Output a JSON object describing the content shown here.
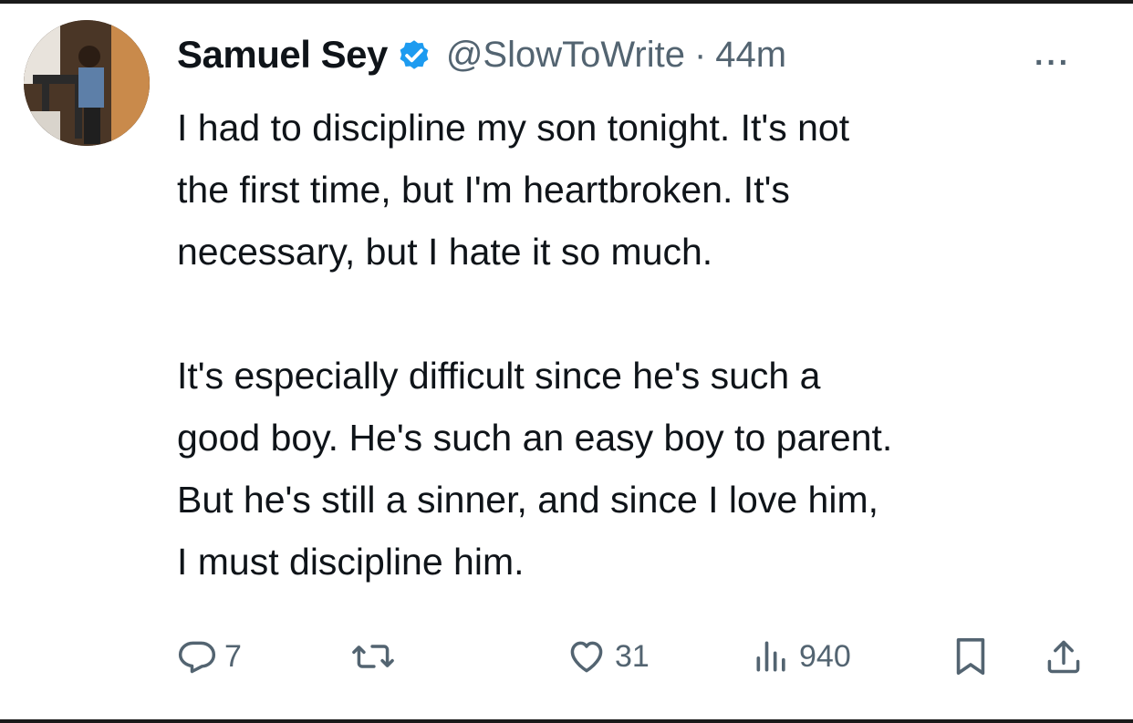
{
  "tweet": {
    "display_name": "Samuel Sey",
    "handle": "@SlowToWrite",
    "separator": "·",
    "time": "44m",
    "more": "···",
    "paragraphs": [
      [
        "I had to discipline my son tonight. It's not",
        "the first time, but I'm heartbroken. It's",
        "necessary, but I hate it so much."
      ],
      [
        "It's especially difficult since he's such a",
        "good boy. He's such an easy boy to parent.",
        "But he's still a sinner, and since I love him,",
        "I must discipline him."
      ]
    ],
    "verified_color": "#1d9bf0"
  },
  "actions": {
    "reply": {
      "icon": "reply-icon",
      "count": "7"
    },
    "repost": {
      "icon": "repost-icon",
      "count": ""
    },
    "like": {
      "icon": "heart-icon",
      "count": "31"
    },
    "views": {
      "icon": "views-icon",
      "count": "940"
    },
    "bookmark": {
      "icon": "bookmark-icon"
    },
    "share": {
      "icon": "share-icon"
    }
  }
}
